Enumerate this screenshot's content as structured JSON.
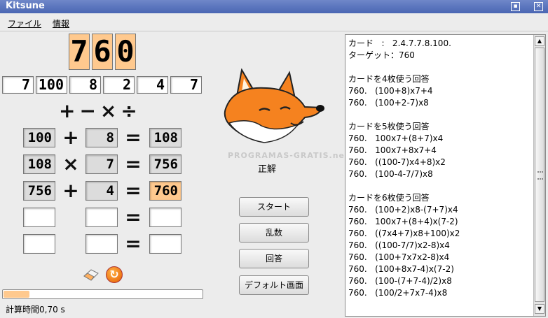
{
  "window": {
    "title": "Kitsune",
    "buttons": [
      "▪",
      "✕"
    ]
  },
  "menu": [
    "ファイル",
    "情報"
  ],
  "target_digits": [
    "7",
    "6",
    "0"
  ],
  "cards": [
    "7",
    "100",
    "8",
    "2",
    "4",
    "7"
  ],
  "operators": "+−×÷",
  "rows": [
    {
      "a": "100",
      "op": "+",
      "b": "8",
      "eq": "=",
      "r": "108",
      "r_highlight": false
    },
    {
      "a": "108",
      "op": "×",
      "b": "7",
      "eq": "=",
      "r": "756",
      "r_highlight": false
    },
    {
      "a": "756",
      "op": "+",
      "b": "4",
      "eq": "=",
      "r": "760",
      "r_highlight": true
    },
    {
      "a": "",
      "op": "",
      "b": "",
      "eq": "=",
      "r": "",
      "r_highlight": false
    },
    {
      "a": "",
      "op": "",
      "b": "",
      "eq": "=",
      "r": "",
      "r_highlight": false
    }
  ],
  "status": "正解",
  "watermark": "PROGRAMAS-GRATIS.net",
  "buttons": {
    "start": "スタート",
    "random": "乱数",
    "answer": "回答",
    "default": "デフォルト画面"
  },
  "progress": {
    "fraction": 0.13
  },
  "calc_time": "計算時間0,70 s",
  "results_text": "カード   :   2.4.7.7.8.100.\nターゲット：760\n\nカードを4枚使う回答\n760.   (100+8)x7+4\n760.   (100+2-7)x8\n\nカードを5枚使う回答\n760.   100x7+(8+7)x4\n760.   100x7+8x7+4\n760.   ((100-7)x4+8)x2\n760.   (100-4-7/7)x8\n\nカードを6枚使う回答\n760.   (100+2)x8-(7+7)x4\n760.   100x7+(8+4)x(7-2)\n760.   ((7x4+7)x8+100)x2\n760.   ((100-7/7)x2-8)x4\n760.   (100+7x7x2-8)x4\n760.   (100+8x7-4)x(7-2)\n760.   (100-(7+7-4)/2)x8\n760.   (100/2+7x7-4)x8",
  "colors": {
    "accent": "#ffc98e",
    "titlebar": "#4a66b3",
    "fox": "#f5821f"
  },
  "icons": [
    "eraser-icon",
    "refresh-icon",
    "fox-mascot"
  ]
}
